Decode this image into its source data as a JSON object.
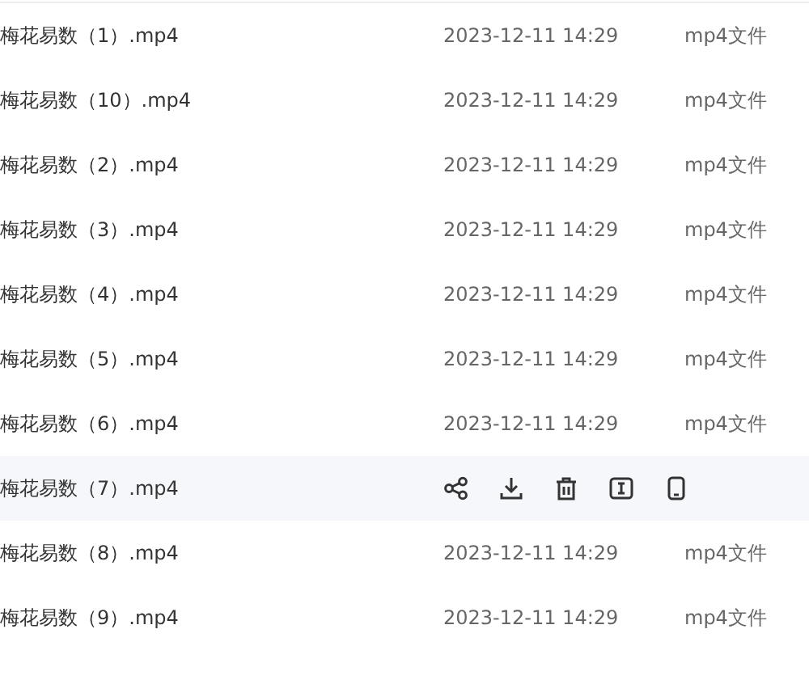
{
  "rows": [
    {
      "name": "梅花易数（1）.mp4",
      "date": "2023-12-11 14:29",
      "type": "mp4文件",
      "hovered": false
    },
    {
      "name": "梅花易数（10）.mp4",
      "date": "2023-12-11 14:29",
      "type": "mp4文件",
      "hovered": false
    },
    {
      "name": "梅花易数（2）.mp4",
      "date": "2023-12-11 14:29",
      "type": "mp4文件",
      "hovered": false
    },
    {
      "name": "梅花易数（3）.mp4",
      "date": "2023-12-11 14:29",
      "type": "mp4文件",
      "hovered": false
    },
    {
      "name": "梅花易数（4）.mp4",
      "date": "2023-12-11 14:29",
      "type": "mp4文件",
      "hovered": false
    },
    {
      "name": "梅花易数（5）.mp4",
      "date": "2023-12-11 14:29",
      "type": "mp4文件",
      "hovered": false
    },
    {
      "name": "梅花易数（6）.mp4",
      "date": "2023-12-11 14:29",
      "type": "mp4文件",
      "hovered": false
    },
    {
      "name": "梅花易数（7）.mp4",
      "hovered": true
    },
    {
      "name": "梅花易数（8）.mp4",
      "date": "2023-12-11 14:29",
      "type": "mp4文件",
      "hovered": false
    },
    {
      "name": "梅花易数（9）.mp4",
      "date": "2023-12-11 14:29",
      "type": "mp4文件",
      "hovered": false
    }
  ]
}
